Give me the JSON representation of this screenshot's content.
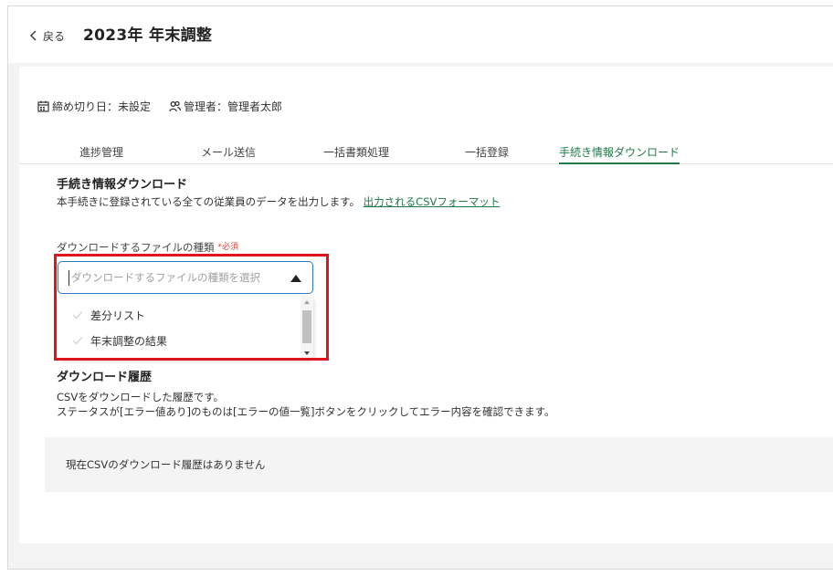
{
  "header": {
    "back_label": "戻る",
    "title": "2023年 年末調整"
  },
  "meta": {
    "deadline": "締め切り日：未設定",
    "manager": "管理者：管理者太郎"
  },
  "tabs": [
    {
      "label": "進捗管理",
      "active": false
    },
    {
      "label": "メール送信",
      "active": false
    },
    {
      "label": "一括書類処理",
      "active": false
    },
    {
      "label": "一括登録",
      "active": false
    },
    {
      "label": "手続き情報ダウンロード",
      "active": true
    }
  ],
  "download_section": {
    "title": "手続き情報ダウンロード",
    "description": "本手続きに登録されている全ての従業員のデータを出力します。",
    "format_link": "出力されるCSVフォーマット",
    "file_type_label": "ダウンロードするファイルの種類",
    "required_mark": "*必須",
    "select_placeholder": "ダウンロードするファイルの種類を選択",
    "options": [
      "差分リスト",
      "年末調整の結果"
    ]
  },
  "history_section": {
    "title": "ダウンロード履歴",
    "description_line1": "CSVをダウンロードした履歴です。",
    "description_line2": "ステータスが[エラー値あり]のものは[エラーの値一覧]ボタンをクリックしてエラー内容を確認できます。",
    "empty_message": "現在CSVのダウンロード履歴はありません"
  },
  "colors": {
    "accent_green": "#1f7a47",
    "select_border": "#2f7ac6",
    "highlight_red": "#e0141c",
    "required_red": "#d04a3c"
  }
}
